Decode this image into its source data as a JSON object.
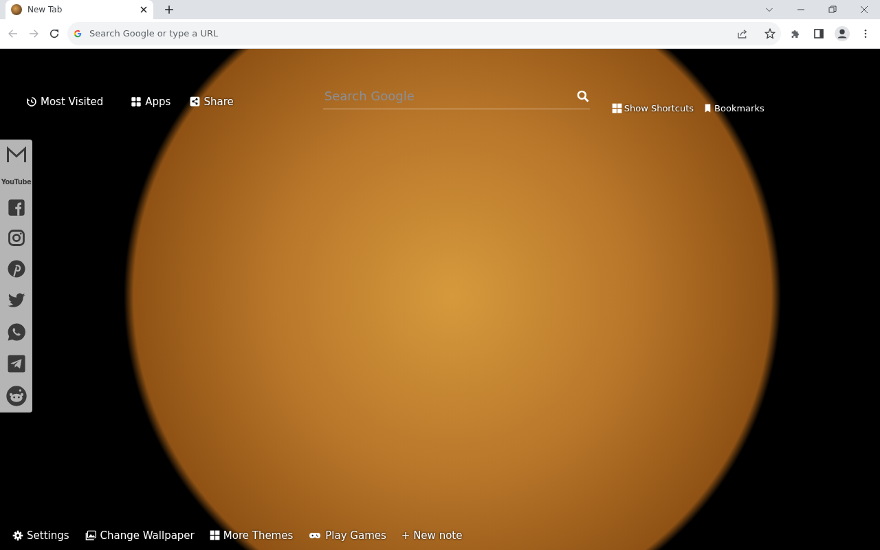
{
  "tabs": [
    {
      "title": "New Tab",
      "selected": true
    }
  ],
  "address_bar": {
    "placeholder": "Search Google or type a URL"
  },
  "top_links": [
    {
      "label": "Most Visited",
      "kind": "history"
    },
    {
      "label": "Apps",
      "kind": "apps"
    },
    {
      "label": "Share",
      "kind": "share"
    }
  ],
  "search": {
    "placeholder": "Search Google"
  },
  "right_links": [
    {
      "label": "Show Shortcuts",
      "kind": "grid"
    },
    {
      "label": "Bookmarks",
      "kind": "bookmark"
    }
  ],
  "sidebar": {
    "youtube_label": "YouTube"
  },
  "bottom_links": [
    {
      "label": "Settings",
      "kind": "gear"
    },
    {
      "label": "Change Wallpaper",
      "kind": "images"
    },
    {
      "label": "More Themes",
      "kind": "grid"
    },
    {
      "label": "Play Games",
      "kind": "gamepad"
    },
    {
      "label": "+ New note",
      "kind": "none"
    }
  ]
}
